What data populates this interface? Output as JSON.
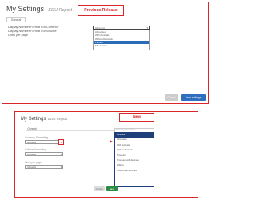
{
  "previous_release": {
    "title": "My Settings",
    "report_name": "- EDU Report",
    "callout": "Previous Release",
    "tab": "General",
    "fields": [
      {
        "label": "Display Number Format For Currency"
      },
      {
        "label": "Display Number Format For Volume"
      },
      {
        "label": "Lines per page"
      }
    ],
    "select_value": "Abrevkot",
    "options": [
      "Abreviated",
      "With decimals",
      "Without Decimals",
      "Percent",
      "Thousands"
    ],
    "selected_index": 3,
    "cancel_label": "Cancel",
    "save_label": "Save settings"
  },
  "new": {
    "title": "My Settings",
    "report_name": "EDU Report",
    "callout": "New",
    "tab": "General",
    "fields": [
      {
        "label": "Currency Formatting",
        "value": "Abrevkot"
      },
      {
        "label": "Volume Formatting",
        "value": "Abrevkot"
      },
      {
        "label": "Lines per page",
        "value": "Abrevkot"
      }
    ],
    "list_header": "Currency Formatting",
    "options": [
      "Abrevkot",
      "Abreviated",
      "With decimals",
      "Without decimals",
      "Thousand",
      "Thousand with decimals",
      "Millions",
      "Millions with decimals"
    ],
    "selected_index": 0,
    "cancel_label": "Cancel",
    "save_label": "Save"
  },
  "colors": {
    "callout_red": "#d9262b",
    "save_blue": "#2f6dbe",
    "save_green": "#2e8b45",
    "list_border": "#1f3f7a"
  }
}
